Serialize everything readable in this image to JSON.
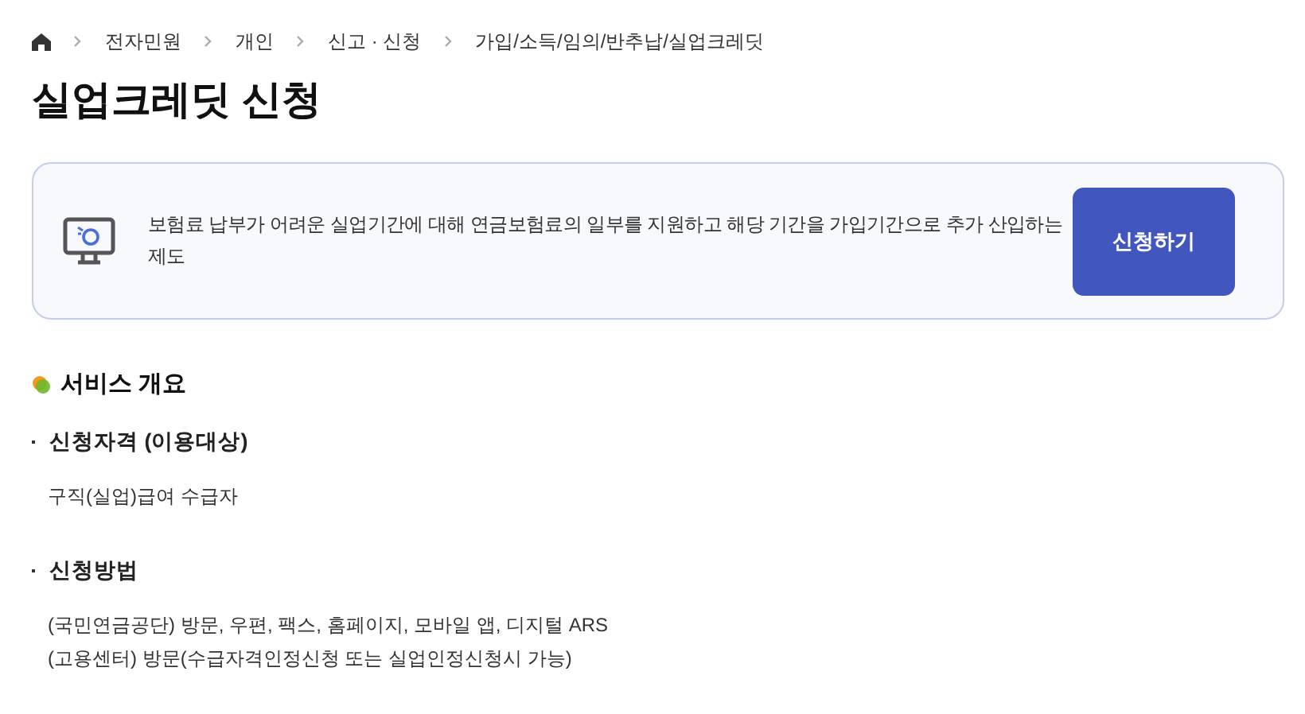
{
  "breadcrumb": [
    "전자민원",
    "개인",
    "신고 · 신청",
    "가입/소득/임의/반추납/실업크레딧"
  ],
  "title": "실업크레딧 신청",
  "intro": {
    "description": "보험료 납부가 어려운 실업기간에 대해 연금보험료의 일부를 지원하고 해당 기간을 가입기간으로 추가 산입하는 제도",
    "button": "신청하기"
  },
  "section": {
    "heading": "서비스 개요",
    "items": [
      {
        "title": "신청자격 (이용대상)",
        "lines": [
          "구직(실업)급여 수급자"
        ]
      },
      {
        "title": "신청방법",
        "lines": [
          "(국민연금공단) 방문, 우편, 팩스, 홈페이지, 모바일 앱, 디지털 ARS",
          "(고용센터) 방문(수급자격인정신청 또는 실업인정신청시 가능)"
        ]
      }
    ]
  }
}
